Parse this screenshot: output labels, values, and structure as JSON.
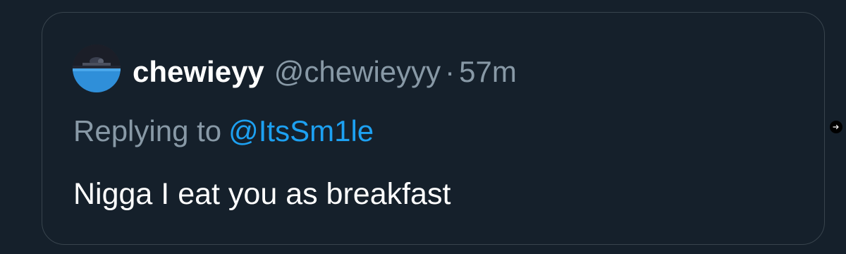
{
  "tweet": {
    "display_name": "chewieyy",
    "handle": "@chewieyyy",
    "separator": "·",
    "time": "57m",
    "replying_prefix": "Replying to",
    "replying_to": "@ItsSm1le",
    "text": "Nigga I eat you as breakfast"
  },
  "icons": {
    "avatar": "avatar-image",
    "next": "arrow-right-icon"
  },
  "colors": {
    "background": "#15202b",
    "border": "#38444d",
    "primary_text": "#ffffff",
    "secondary_text": "#8899a6",
    "mention": "#1da1f2"
  }
}
